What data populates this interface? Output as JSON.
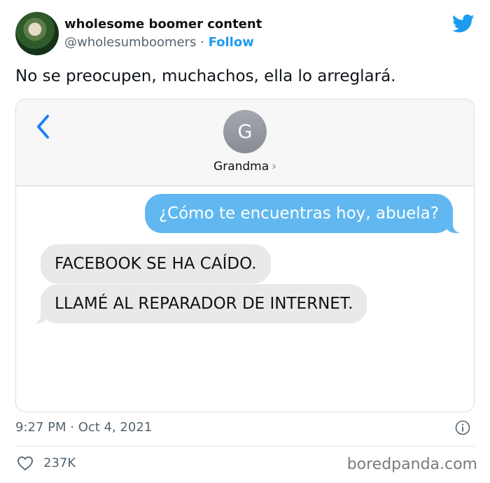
{
  "account": {
    "display_name": "wholesome boomer content",
    "handle": "@wholesumboomers",
    "separator": " · ",
    "follow_label": "Follow"
  },
  "tweet": {
    "text": "No se preocupen, muchachos, ella lo arreglará.",
    "timestamp": "9:27 PM · Oct 4, 2021",
    "likes": "237K"
  },
  "conversation": {
    "contact_initial": "G",
    "contact_name": "Grandma",
    "chevron": "›",
    "messages": [
      {
        "from": "me",
        "text": "¿Cómo te encuentras hoy, abuela?"
      },
      {
        "from": "grandma",
        "text": "FACEBOOK SE HA CAÍDO."
      },
      {
        "from": "grandma",
        "text": "LLAMÉ AL REPARADOR DE INTERNET."
      }
    ]
  },
  "watermark": "boredpanda.com",
  "icons": {
    "brand": "twitter-bird-icon",
    "back": "chevron-left-icon",
    "info": "info-icon",
    "like": "heart-icon"
  },
  "colors": {
    "follow": "#1d9bf0",
    "sent_bubble": "#61b8f0",
    "received_bubble": "#e9e9eb",
    "twitter_blue": "#1d9bf0"
  }
}
